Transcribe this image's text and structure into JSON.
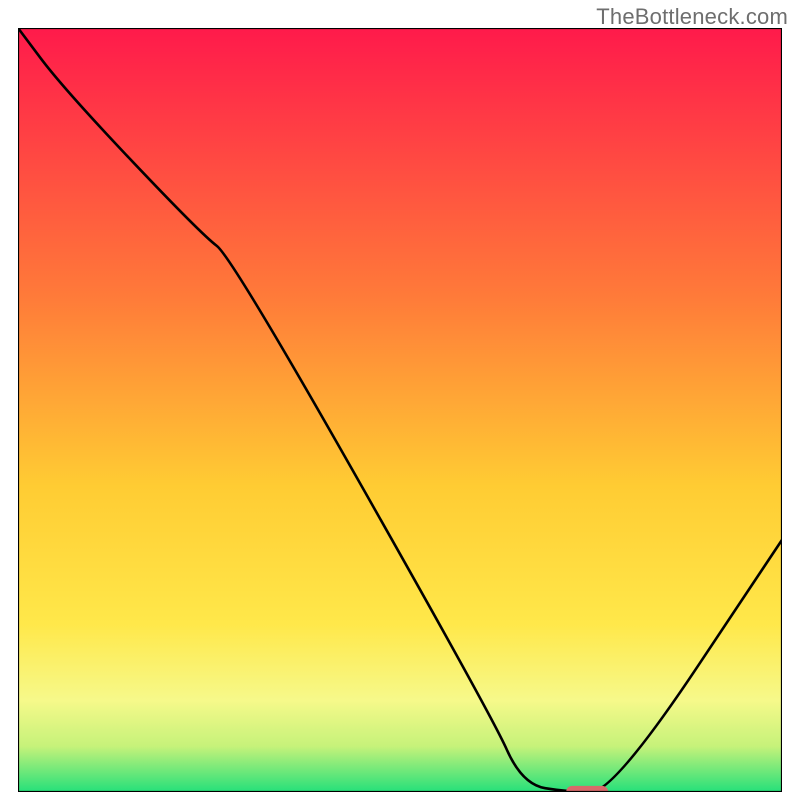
{
  "watermark": "TheBottleneck.com",
  "chart_data": {
    "type": "line",
    "title": "",
    "xlabel": "",
    "ylabel": "",
    "xlim": [
      0,
      100
    ],
    "ylim": [
      0,
      100
    ],
    "gradient_stops": [
      {
        "offset": 0,
        "color": "#ff1a4b"
      },
      {
        "offset": 35,
        "color": "#ff7a39"
      },
      {
        "offset": 60,
        "color": "#ffcc33"
      },
      {
        "offset": 78,
        "color": "#ffe84a"
      },
      {
        "offset": 88,
        "color": "#f6f98a"
      },
      {
        "offset": 94,
        "color": "#c6f27a"
      },
      {
        "offset": 100,
        "color": "#25e07a"
      }
    ],
    "series": [
      {
        "name": "bottleneck-curve",
        "x": [
          0,
          6,
          24,
          28,
          62,
          66,
          72,
          78,
          100
        ],
        "y": [
          100,
          92,
          73,
          70,
          10,
          1,
          0,
          0,
          33
        ]
      }
    ],
    "marker": {
      "name": "optimal-marker",
      "x": 74.5,
      "y": 0,
      "width_pct": 5.5,
      "height_pct": 1.6,
      "color": "#d76a6a"
    },
    "frame_stroke": "#000000",
    "frame_stroke_width": 2.2
  }
}
